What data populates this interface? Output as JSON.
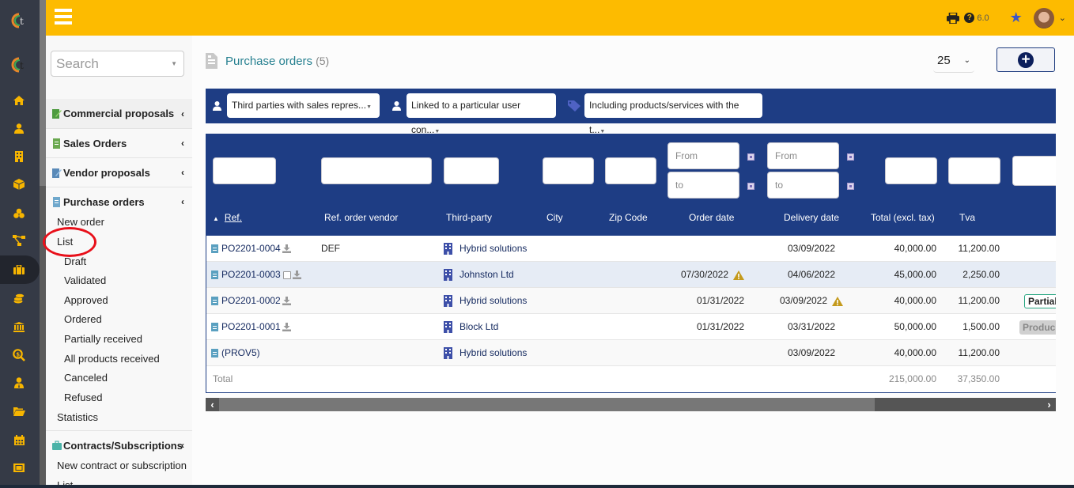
{
  "topbar": {
    "version": "6.0"
  },
  "sidebar": {
    "search_placeholder": "Search",
    "sections": [
      {
        "label": "Commercial proposals"
      },
      {
        "label": "Sales Orders"
      },
      {
        "label": "Vendor proposals"
      },
      {
        "label": "Purchase orders"
      },
      {
        "label": "Contracts/Subscriptions"
      }
    ],
    "purchase_items": {
      "new_order": "New order",
      "list": "List",
      "draft": "Draft",
      "validated": "Validated",
      "approved": "Approved",
      "ordered": "Ordered",
      "partially_received": "Partially received",
      "all_received": "All products received",
      "canceled": "Canceled",
      "refused": "Refused",
      "statistics": "Statistics"
    },
    "contract_items": {
      "new": "New contract or subscription",
      "list": "List"
    }
  },
  "main": {
    "title": "Purchase orders",
    "count": "(5)",
    "limit": "25",
    "filters": [
      {
        "label": "Third parties with sales repres..."
      },
      {
        "label": "Linked to a particular user con..."
      },
      {
        "label": "Including products/services with the t..."
      }
    ],
    "date_from_placeholder": "From",
    "date_to_placeholder": "to",
    "columns": {
      "ref": "Ref.",
      "ref_vendor": "Ref. order vendor",
      "third_party": "Third-party",
      "city": "City",
      "zip": "Zip Code",
      "order_date": "Order date",
      "delivery_date": "Delivery date",
      "total_ht": "Total (excl. tax)",
      "tva": "Tva"
    },
    "rows": [
      {
        "ref": "PO2201-0004",
        "ref_vendor": "DEF",
        "third_party": "Hybrid solutions",
        "order_date": "",
        "delivery_date": "03/09/2022",
        "total_ht": "40,000.00",
        "tva": "11,200.00",
        "status": ""
      },
      {
        "ref": "PO2201-0003",
        "ref_vendor": "",
        "third_party": "Johnston Ltd",
        "order_date": "07/30/2022",
        "delivery_date": "04/06/2022",
        "total_ht": "45,000.00",
        "tva": "2,250.00",
        "status": ""
      },
      {
        "ref": "PO2201-0002",
        "ref_vendor": "",
        "third_party": "Hybrid solutions",
        "order_date": "01/31/2022",
        "delivery_date": "03/09/2022",
        "total_ht": "40,000.00",
        "tva": "11,200.00",
        "status": "Partial"
      },
      {
        "ref": "PO2201-0001",
        "ref_vendor": "",
        "third_party": "Block Ltd",
        "order_date": "01/31/2022",
        "delivery_date": "03/31/2022",
        "total_ht": "50,000.00",
        "tva": "1,500.00",
        "status": "Produc"
      },
      {
        "ref": "(PROV5)",
        "ref_vendor": "",
        "third_party": "Hybrid solutions",
        "order_date": "",
        "delivery_date": "03/09/2022",
        "total_ht": "40,000.00",
        "tva": "11,200.00",
        "status": ""
      }
    ],
    "total": {
      "label": "Total",
      "total_ht": "215,000.00",
      "tva": "37,350.00"
    }
  },
  "colors": {
    "topbar": "#fdbb00",
    "rail": "#353a46",
    "table_header": "#1e3d84",
    "link": "#14295f",
    "title": "#268090",
    "icon_accent": "#f7b500"
  }
}
